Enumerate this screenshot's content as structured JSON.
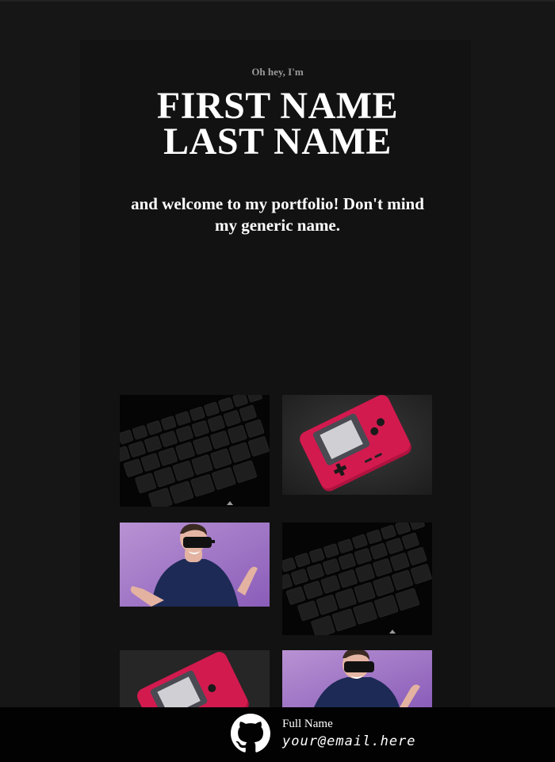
{
  "hero": {
    "intro": "Oh hey, I'm",
    "first_name": "FIRST NAME",
    "last_name": "LAST NAME",
    "tagline": "and welcome to my portfolio! Don't mind my generic name."
  },
  "gallery": {
    "items": [
      {
        "subject": "keyboard-photo"
      },
      {
        "subject": "handheld-console-photo"
      },
      {
        "subject": "vr-headset-person-photo"
      },
      {
        "subject": "keyboard-photo"
      },
      {
        "subject": "handheld-console-photo"
      },
      {
        "subject": "vr-headset-person-photo"
      }
    ]
  },
  "footer": {
    "icon": "github-icon",
    "full_name": "Full Name",
    "email": "your@email.here"
  },
  "colors": {
    "background": "#161616",
    "panel": "#121212",
    "footer": "#020202",
    "console_red": "#c8184a",
    "vr_purple": "#9b6cc0"
  }
}
